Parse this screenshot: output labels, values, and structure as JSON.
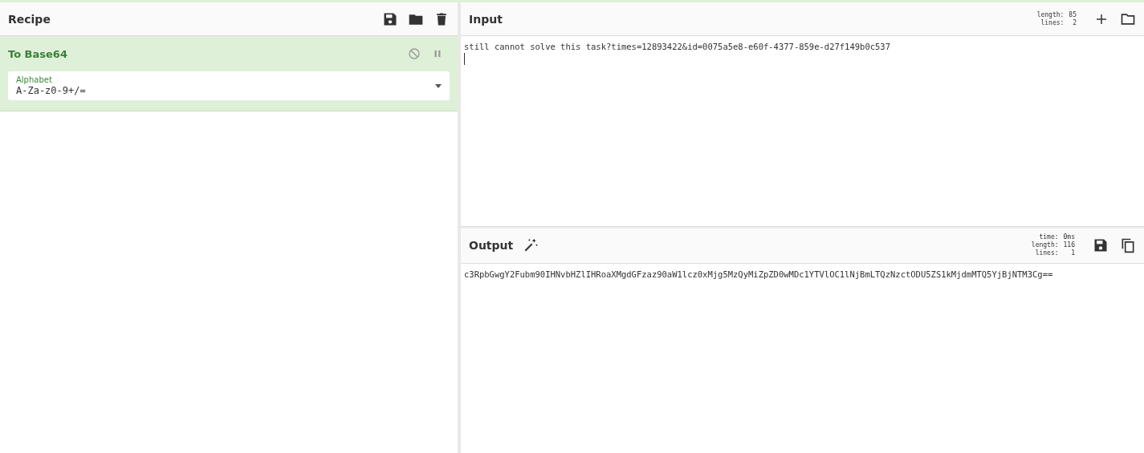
{
  "recipe": {
    "title": "Recipe",
    "operations": [
      {
        "name": "To Base64",
        "args": [
          {
            "label": "Alphabet",
            "value": "A-Za-z0-9+/="
          }
        ]
      }
    ]
  },
  "input": {
    "title": "Input",
    "stats": [
      {
        "label": "length:",
        "value": "85"
      },
      {
        "label": "lines:",
        "value": "2"
      }
    ],
    "value": "still cannot solve this task?times=12893422&id=0075a5e8-e60f-4377-859e-d27f149b0c537"
  },
  "output": {
    "title": "Output",
    "stats": [
      {
        "label": "time:",
        "value": "0ms"
      },
      {
        "label": "length:",
        "value": "116"
      },
      {
        "label": "lines:",
        "value": "1"
      }
    ],
    "value": "c3RpbGwgY2Fubm90IHNvbHZlIHRoaXMgdGFzaz90aW1lcz0xMjg5MzQyMiZpZD0wMDc1YTVlOC1lNjBmLTQzNzctODU5ZS1kMjdmMTQ5YjBjNTM3Cg=="
  }
}
